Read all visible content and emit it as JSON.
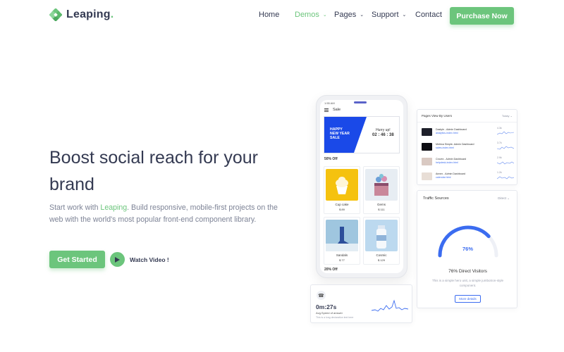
{
  "brand": {
    "name": "Leaping",
    "dot": ".",
    "accent": "#6cc57c"
  },
  "nav": {
    "items": [
      {
        "label": "Home",
        "dropdown": false,
        "active": false
      },
      {
        "label": "Demos",
        "dropdown": true,
        "active": true
      },
      {
        "label": "Pages",
        "dropdown": true,
        "active": false
      },
      {
        "label": "Support",
        "dropdown": true,
        "active": false
      },
      {
        "label": "Contact",
        "dropdown": false,
        "active": false
      }
    ],
    "cta": "Purchase Now"
  },
  "hero": {
    "title": "Boost social reach for your brand",
    "text_before": "Start work with ",
    "text_highlight": "Leaping",
    "text_after": ". Build responsive, mobile-first projects on the web with the world's most popular front-end component library.",
    "primary_button": "Get Started",
    "video_button": "Watch Video !"
  },
  "phone": {
    "status_time": "1:55 AM",
    "header": "Sale",
    "banner_line1": "HAPPY",
    "banner_line2": "NEW YEAR",
    "banner_line3": "SALE",
    "hurry": "Hurry up!",
    "countdown": "02 : 46 : 38",
    "off_label_1": "50% Off",
    "off_label_2": "20% Off",
    "products": [
      {
        "name": "Cup cake",
        "price": "$ 89",
        "color": "#f5c20f"
      },
      {
        "name": "Gems",
        "price": "$ 111",
        "color": "#e7edf3"
      },
      {
        "name": "Sandals",
        "price": "$ 77",
        "color": "#9fc6df"
      },
      {
        "name": "Cosmic",
        "price": "$ 129",
        "color": "#bcd9ef"
      }
    ]
  },
  "pages_card": {
    "title": "Pages View By Users",
    "filter": "Today ⌄",
    "rows": [
      {
        "title": "Dastyle - Admin Dashboard",
        "link": "analytics-index.html",
        "value": "4.3k"
      },
      {
        "title": "Metrica Simple- Admin Dashboard",
        "link": "sales-index.html",
        "value": "3.7k"
      },
      {
        "title": "Crovex - Admin Dashboard",
        "link": "helpdesk-index.html",
        "value": "2.9k"
      },
      {
        "title": "Annex - Admin Dashboard",
        "link": "calendar.html",
        "value": "1.2k"
      }
    ]
  },
  "traffic_card": {
    "title": "Traffic Sources",
    "filter": "Direct ⌄",
    "gauge_value": "76%",
    "gauge_fraction": 0.76,
    "headline": "76% Direct Visitors",
    "subtext": "This is a simple hero unit, a simple jumbotron-style component.",
    "button": "More details"
  },
  "speed_card": {
    "value": "0m:27s",
    "label": "Avg.Speed of answer",
    "desc": "This is a long declaration text here"
  }
}
